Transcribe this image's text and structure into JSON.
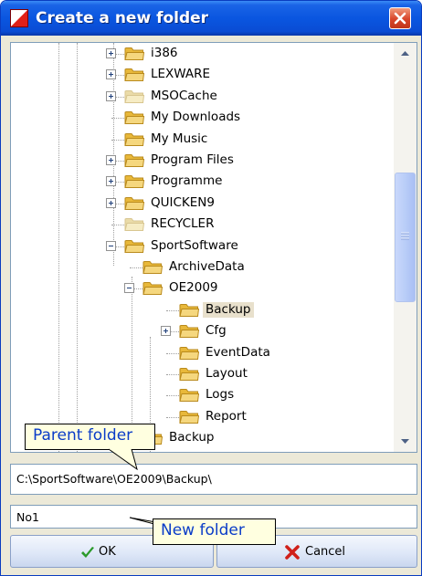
{
  "dialog": {
    "title": "Create a new folder"
  },
  "tree": {
    "items": [
      {
        "label": "i386",
        "expander": "plus",
        "selected": false,
        "dim": false
      },
      {
        "label": "LEXWARE",
        "expander": "plus",
        "selected": false,
        "dim": false
      },
      {
        "label": "MSOCache",
        "expander": "plus",
        "selected": false,
        "dim": true
      },
      {
        "label": "My Downloads",
        "expander": "none",
        "selected": false,
        "dim": false
      },
      {
        "label": "My Music",
        "expander": "none",
        "selected": false,
        "dim": false
      },
      {
        "label": "Program Files",
        "expander": "plus",
        "selected": false,
        "dim": false
      },
      {
        "label": "Programme",
        "expander": "plus",
        "selected": false,
        "dim": false
      },
      {
        "label": "QUICKEN9",
        "expander": "plus",
        "selected": false,
        "dim": false
      },
      {
        "label": "RECYCLER",
        "expander": "none",
        "selected": false,
        "dim": true
      },
      {
        "label": "SportSoftware",
        "expander": "minus",
        "selected": false,
        "dim": false
      },
      {
        "label": "ArchiveData",
        "expander": "none",
        "selected": false,
        "dim": false
      },
      {
        "label": "OE2009",
        "expander": "minus",
        "selected": false,
        "dim": false
      },
      {
        "label": "Backup",
        "expander": "none",
        "selected": true,
        "dim": false
      },
      {
        "label": "Cfg",
        "expander": "plus",
        "selected": false,
        "dim": false
      },
      {
        "label": "EventData",
        "expander": "none",
        "selected": false,
        "dim": false
      },
      {
        "label": "Layout",
        "expander": "none",
        "selected": false,
        "dim": false
      },
      {
        "label": "Logs",
        "expander": "none",
        "selected": false,
        "dim": false
      },
      {
        "label": "Report",
        "expander": "none",
        "selected": false,
        "dim": false
      },
      {
        "label": "Backup",
        "expander": "none",
        "selected": false,
        "dim": false
      }
    ]
  },
  "path_display": "C:\\SportSoftware\\OE2009\\Backup\\",
  "new_folder_input": {
    "value": "No1"
  },
  "buttons": {
    "ok": "OK",
    "cancel": "Cancel"
  },
  "callouts": {
    "parent": "Parent folder",
    "new": "New folder"
  },
  "icons": {
    "title": "app-flag-icon",
    "close": "close-icon",
    "folder": "folder-icon",
    "ok": "checkmark-icon",
    "cancel": "cross-icon"
  },
  "colors": {
    "titlebar": "#0a56e0",
    "selection": "#e8e0cc",
    "callout_bg": "#ffffe0",
    "callout_text": "#0a3cc8"
  }
}
